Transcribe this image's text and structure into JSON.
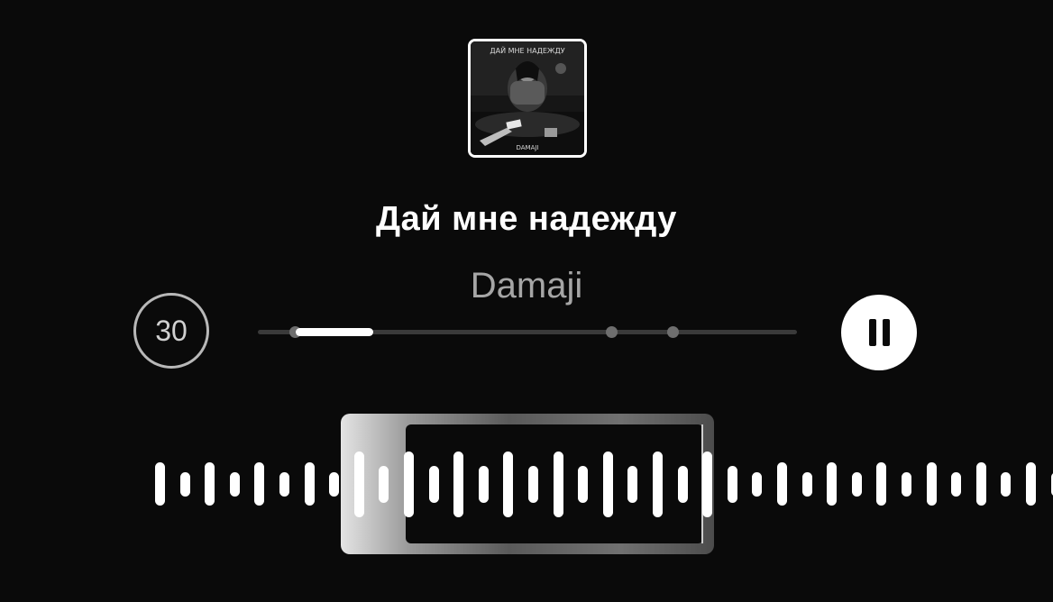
{
  "player": {
    "cover_alt": "Дай мне надежду — Damaji cover art",
    "cover_title_text": "ДАЙ МНЕ НАДЕЖДУ",
    "cover_artist_text": "DAMAJI",
    "track_title": "Дай мне надежду",
    "artist": "Damaji",
    "skip_label": "30",
    "skip_icon": "skip-30-icon",
    "pause_icon": "pause-icon"
  },
  "progress": {
    "played_fraction": 0.143,
    "marker_fractions": [
      0.07,
      0.657,
      0.77
    ]
  },
  "waveform": {
    "bar_heights": [
      0.31,
      0.17,
      0.31,
      0.17,
      0.31,
      0.17,
      0.31,
      0.17,
      0.47,
      0.26,
      0.47,
      0.26,
      0.47,
      0.26,
      0.47,
      0.26,
      0.47,
      0.26,
      0.47,
      0.26,
      0.47,
      0.26,
      0.47,
      0.26,
      0.17,
      0.31,
      0.17,
      0.31,
      0.17,
      0.31,
      0.17,
      0.31,
      0.17,
      0.31,
      0.17,
      0.31,
      0.17,
      0.31
    ],
    "selection": {
      "start": 0.385,
      "end": 0.667
    }
  },
  "colors": {
    "background": "#0a0a0a",
    "text": "#ffffff",
    "secondary_text": "#a6a6a6",
    "progress_track": "#3a3a3a"
  }
}
